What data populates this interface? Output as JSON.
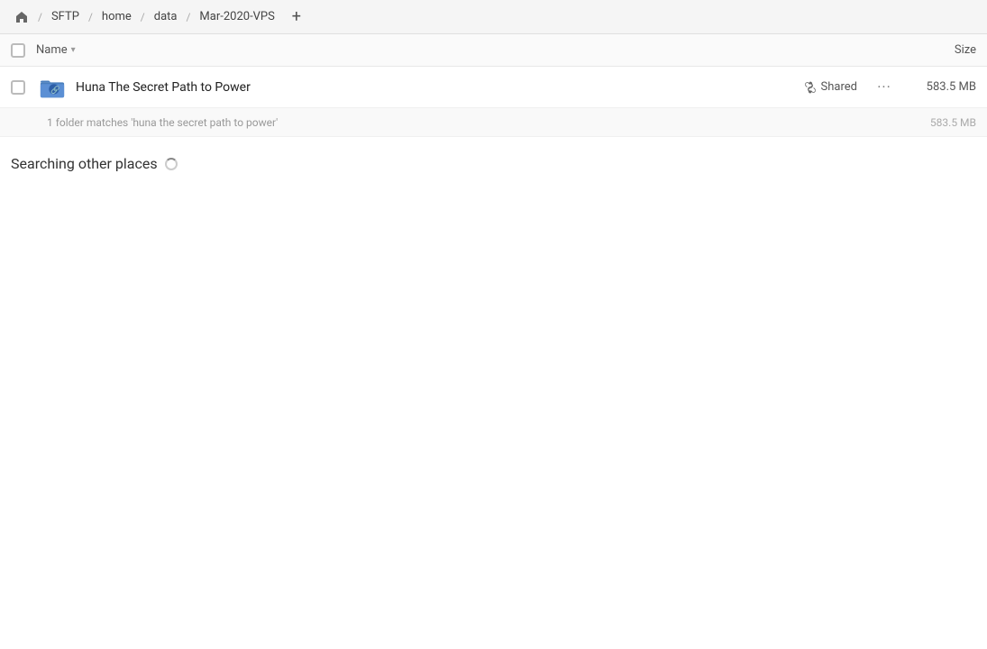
{
  "breadcrumb": {
    "home_icon": "⌂",
    "items": [
      {
        "label": "SFTP"
      },
      {
        "label": "home"
      },
      {
        "label": "data"
      },
      {
        "label": "Mar-2020-VPS"
      }
    ],
    "add_label": "+"
  },
  "columns": {
    "name_label": "Name",
    "size_label": "Size"
  },
  "file_row": {
    "icon_color": "#4a7fbd",
    "name": "Huna The Secret Path to Power",
    "shared_label": "Shared",
    "size": "583.5 MB"
  },
  "info_row": {
    "text": "1 folder matches 'huna the secret path to power'",
    "size": "583.5 MB"
  },
  "searching": {
    "title": "Searching other places"
  }
}
